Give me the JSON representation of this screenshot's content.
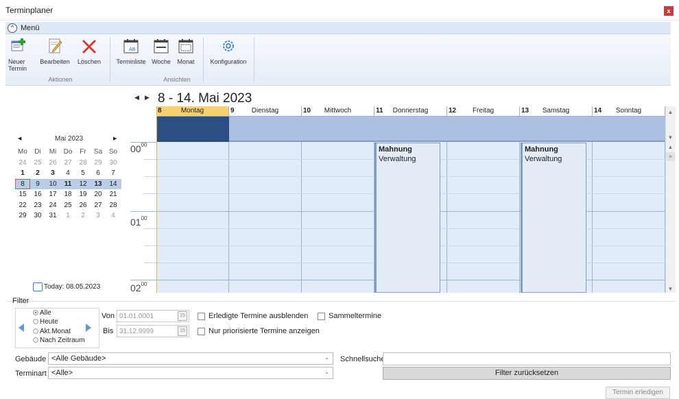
{
  "window": {
    "title": "Terminplaner",
    "close": "x"
  },
  "menu": {
    "toggle_icon": "chevron-up-circle",
    "label": "Menü"
  },
  "ribbon": {
    "actions": [
      {
        "label": "Neuer\nTermin",
        "icon": "new-appointment-icon"
      },
      {
        "label": "Bearbeiten",
        "icon": "edit-icon"
      },
      {
        "label": "Löschen",
        "icon": "delete-icon"
      }
    ],
    "actions_group": "Aktionen",
    "views": [
      {
        "label": "Terminliste",
        "icon": "list-calendar-icon"
      },
      {
        "label": "Woche",
        "icon": "week-calendar-icon"
      },
      {
        "label": "Monat",
        "icon": "month-calendar-icon"
      },
      {
        "label": "Konfiguration",
        "icon": "gear-icon"
      }
    ],
    "views_group": "Ansichten"
  },
  "week": {
    "prev": "◀",
    "next": "▶",
    "title": "8 - 14. Mai 2023"
  },
  "mini_calendar": {
    "title": "Mai 2023",
    "prev": "◀",
    "next": "▶",
    "weekdays": [
      "Mo",
      "Di",
      "Mi",
      "Do",
      "Fr",
      "Sa",
      "So"
    ],
    "weeks": [
      [
        "24",
        "25",
        "26",
        "27",
        "28",
        "29",
        "30"
      ],
      [
        "1",
        "2",
        "3",
        "4",
        "5",
        "6",
        "7"
      ],
      [
        "8",
        "9",
        "10",
        "11",
        "12",
        "13",
        "14"
      ],
      [
        "15",
        "16",
        "17",
        "18",
        "19",
        "20",
        "21"
      ],
      [
        "22",
        "23",
        "24",
        "25",
        "26",
        "27",
        "28"
      ],
      [
        "29",
        "30",
        "31",
        "1",
        "2",
        "3",
        "4"
      ]
    ],
    "today_label": "Today: 08.05.2023"
  },
  "days": [
    {
      "num": "8",
      "name": "Montag"
    },
    {
      "num": "9",
      "name": "Dienstag"
    },
    {
      "num": "10",
      "name": "Mittwoch"
    },
    {
      "num": "11",
      "name": "Donnerstag"
    },
    {
      "num": "12",
      "name": "Freitag"
    },
    {
      "num": "13",
      "name": "Samstag"
    },
    {
      "num": "14",
      "name": "Sonntag"
    }
  ],
  "times": [
    {
      "hour": "00",
      "min": "00"
    },
    {
      "hour": "01",
      "min": "00"
    },
    {
      "hour": "02",
      "min": "00"
    }
  ],
  "appointments": [
    {
      "title": "Mahnung",
      "subtitle": "Verwaltung"
    },
    {
      "title": "Mahnung",
      "subtitle": "Verwaltung"
    }
  ],
  "filter": {
    "legend": "Filter",
    "radios": [
      "Alle",
      "Heute",
      "Akt.Monat",
      "Nach Zeitraum"
    ],
    "von_label": "Von",
    "von_value": "01.01.0001",
    "bis_label": "Bis",
    "bis_value": "31.12.9999",
    "cal_icon": "15",
    "erledigte": "Erledigte Termine ausblenden",
    "priorisierte": "Nur priorisierte Termine anzeigen",
    "sammel": "Sammeltermine",
    "gebaeude_label": "Gebäude",
    "gebaeude_value": "<Alle Gebäude>",
    "terminart_label": "Terminart",
    "terminart_value": "<Alle>",
    "schnellsuche_label": "Schnellsuche",
    "reset": "Filter zurücksetzen"
  },
  "footer": {
    "erledigen": "Termin erledigen"
  }
}
